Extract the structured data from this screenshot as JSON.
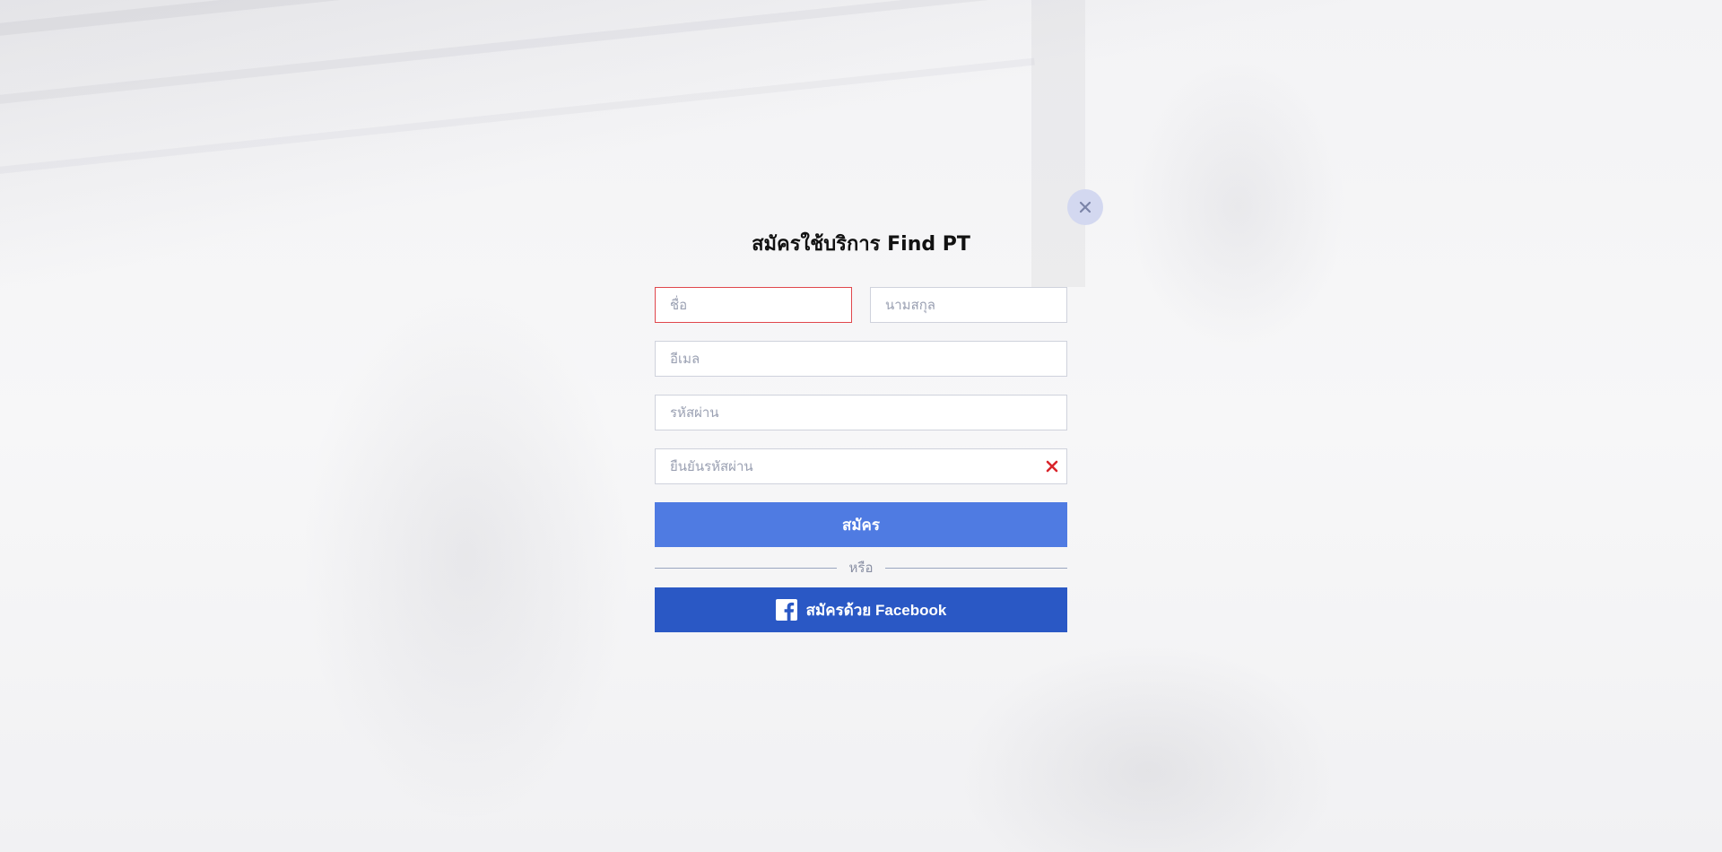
{
  "modal": {
    "title": "สมัครใช้บริการ Find PT",
    "close_icon": "close-icon"
  },
  "form": {
    "first_name": {
      "placeholder": "ชื่อ",
      "value": "",
      "state": "error"
    },
    "last_name": {
      "placeholder": "นามสกุล",
      "value": ""
    },
    "email": {
      "placeholder": "อีเมล",
      "value": ""
    },
    "password": {
      "placeholder": "รหัสผ่าน",
      "value": ""
    },
    "confirm_password": {
      "placeholder": "ยืนยันรหัสผ่าน",
      "value": "",
      "state": "error"
    },
    "submit_label": "สมัคร",
    "divider_label": "หรือ",
    "facebook_label": "สมัครด้วย Facebook"
  },
  "colors": {
    "primary": "#4f7be2",
    "facebook": "#2a58c5",
    "error": "#e0474c",
    "close_bg": "#d3d8f0"
  }
}
